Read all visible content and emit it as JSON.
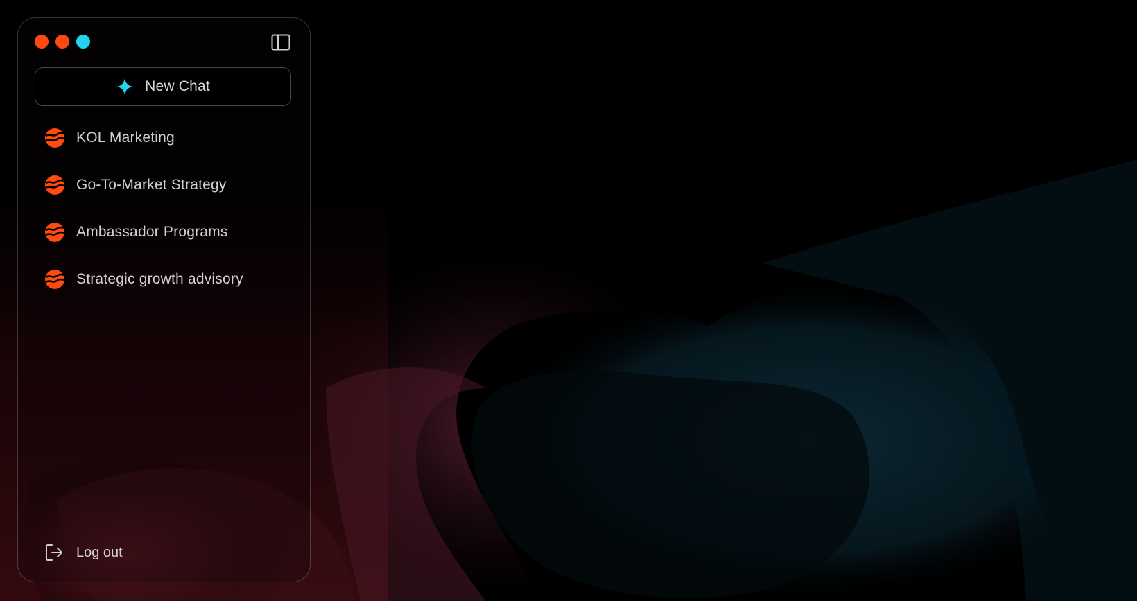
{
  "window": {
    "traffic_lights": [
      {
        "name": "close",
        "color": "#ff4a12"
      },
      {
        "name": "minimize",
        "color": "#ff4a12"
      },
      {
        "name": "maximize",
        "color": "#22d3ee"
      }
    ]
  },
  "sidebar": {
    "toggle_icon": "sidebar-panel-icon",
    "new_chat": {
      "label": "New Chat",
      "icon": "sparkle-icon",
      "icon_color": "#22d3ee"
    },
    "items": [
      {
        "label": "KOL Marketing",
        "icon": "brand-logo-icon"
      },
      {
        "label": "Go-To-Market Strategy",
        "icon": "brand-logo-icon"
      },
      {
        "label": "Ambassador Programs",
        "icon": "brand-logo-icon"
      },
      {
        "label": "Strategic growth advisory",
        "icon": "brand-logo-icon"
      }
    ],
    "logout": {
      "label": "Log out",
      "icon": "logout-icon"
    }
  },
  "colors": {
    "accent_orange": "#ff4a12",
    "accent_cyan": "#22d3ee",
    "text": "#d2d2d6",
    "background": "#000000"
  }
}
